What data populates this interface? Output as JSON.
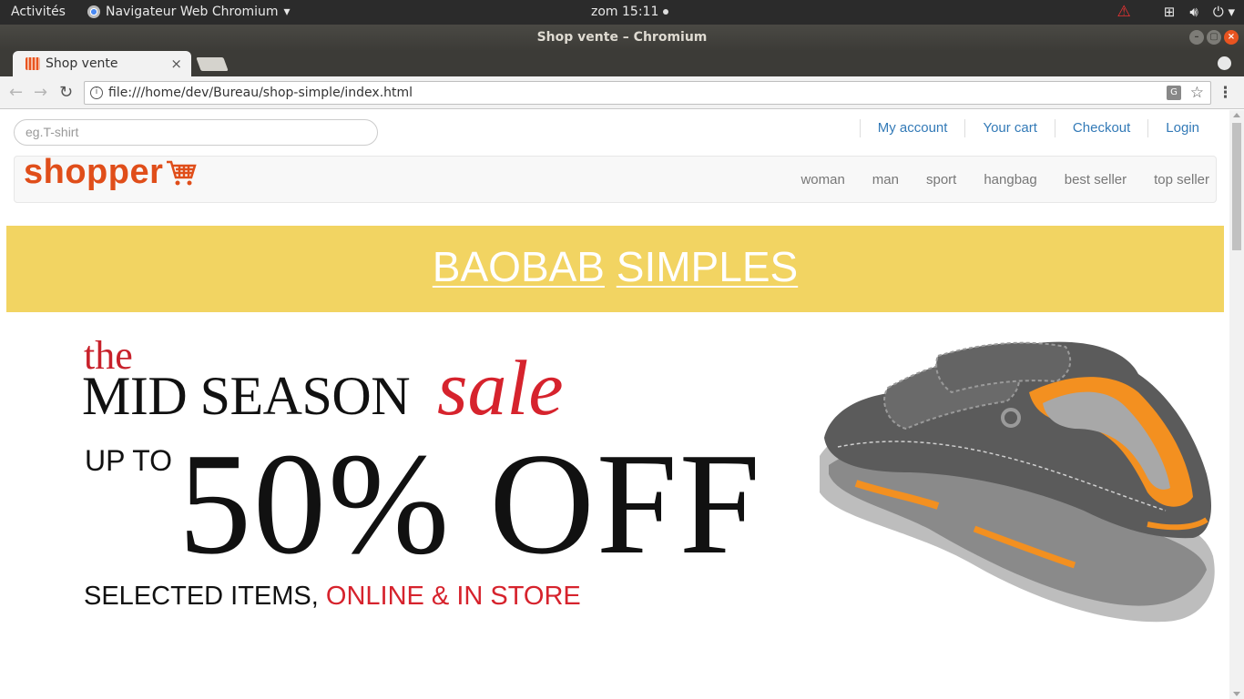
{
  "os_topbar": {
    "activities": "Activités",
    "app_menu": "Navigateur Web Chromium",
    "clock": "zom 15:11"
  },
  "window": {
    "title": "Shop vente – Chromium"
  },
  "browser": {
    "tab_title": "Shop vente",
    "url": "file:///home/dev/Bureau/shop-simple/index.html"
  },
  "page": {
    "search_placeholder": "eg.T-shirt",
    "account_links": [
      "My account",
      "Your cart",
      "Checkout",
      "Login"
    ],
    "logo_text": "shopper",
    "nav_links": [
      "woman",
      "man",
      "sport",
      "hangbag",
      "best seller",
      "top seller"
    ],
    "banner_words": [
      "BAOBAB",
      "SIMPLES"
    ],
    "promo": {
      "the": "the",
      "line1": "MID SEASON",
      "sale": "sale",
      "up_to": "UP TO",
      "discount": "50% OFF",
      "selected": "SELECTED ITEMS,",
      "selected_red": "ONLINE & IN STORE"
    }
  },
  "colors": {
    "logo": "#e04e1a",
    "banner_bg": "#f2d462",
    "link": "#337ab7",
    "sale_red": "#d6232d"
  }
}
